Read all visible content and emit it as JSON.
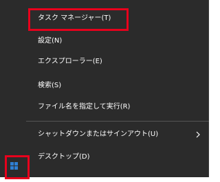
{
  "menu": {
    "items": [
      {
        "label": "タスク マネージャー(T)"
      },
      {
        "label": "設定(N)"
      },
      {
        "label": "エクスプローラー(E)"
      },
      {
        "label": "検索(S)"
      },
      {
        "label": "ファイル名を指定して実行(R)"
      },
      {
        "label": "シャットダウンまたはサインアウト(U)"
      },
      {
        "label": "デスクトップ(D)"
      }
    ]
  },
  "colors": {
    "menu_bg": "#2b2b2b",
    "text": "#ffffff",
    "highlight": "#e8001c",
    "windows_logo": "#2f7fd3"
  },
  "icons": {
    "submenu": "chevron-right-icon",
    "start": "windows-logo-icon"
  }
}
